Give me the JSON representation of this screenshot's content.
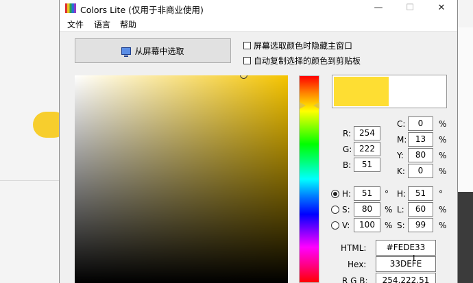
{
  "window": {
    "title": "Colors Lite (仅用于非商业使用)",
    "controls": {
      "minimize": "—",
      "maximize": "☐",
      "close": "✕"
    }
  },
  "menu": [
    "文件",
    "语言",
    "帮助"
  ],
  "pick_button": {
    "label": "从屏幕中选取",
    "icon": "monitor-icon"
  },
  "options": [
    {
      "label": "屏幕选取颜色时隐藏主窗口",
      "checked": false
    },
    {
      "label": "自动复制选择的颜色到剪贴板",
      "checked": false
    }
  ],
  "current_color": "#FEDE33",
  "rgb": {
    "r_label": "R:",
    "r": "254",
    "g_label": "G:",
    "g": "222",
    "b_label": "B:",
    "b": "51"
  },
  "cmyk": {
    "c_label": "C:",
    "c": "0",
    "m_label": "M:",
    "m": "13",
    "y_label": "Y:",
    "y": "80",
    "k_label": "K:",
    "k": "0",
    "unit": "%"
  },
  "hsv": {
    "h_label": "H:",
    "h": "51",
    "h_unit": "°",
    "s_label": "S:",
    "s": "80",
    "s_unit": "%",
    "v_label": "V:",
    "v": "100",
    "v_unit": "%",
    "selected": "H"
  },
  "hsl": {
    "h_label": "H:",
    "h": "51",
    "h_unit": "°",
    "l_label": "L:",
    "l": "60",
    "l_unit": "%",
    "s_label": "S:",
    "s": "99",
    "s_unit": "%"
  },
  "formats": {
    "html_label": "HTML:",
    "html": "#FEDE33",
    "hex_label": "Hex:",
    "hex": "33DEFE",
    "rgb_label": "R G B:",
    "rgb": "254,222,51"
  },
  "colors": {
    "hue_marker": "#e1c43e",
    "background_pill": "#f7ce2d"
  }
}
